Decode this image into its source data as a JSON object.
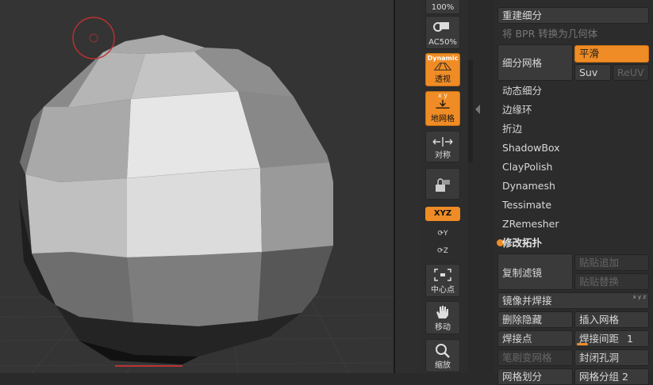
{
  "shelf": {
    "top_partial_label": "100%",
    "ac50_label": "AC50%",
    "persp_label": "透视",
    "persp_tag": "Dynamic",
    "floor_label": "地网格",
    "floor_axes": "x  y",
    "sym_label": "对称",
    "xyz_label": "XYZ",
    "y_label": "Y",
    "z_label": "Z",
    "frame_label": "中心点",
    "move_label": "移动",
    "scale_label": "缩放"
  },
  "panel": {
    "rebuild": "重建细分",
    "bpr_to_geo": "将 BPR 转换为几何体",
    "subdivide": "细分网格",
    "smooth": "平滑",
    "suv": "Suv",
    "reuv": "ReUV",
    "dynamic_subdiv": "动态细分",
    "edge_loop": "边缘环",
    "crease": "折边",
    "shadowbox": "ShadowBox",
    "claypolish": "ClayPolish",
    "dynamesh": "Dynamesh",
    "tessimate": "Tessimate",
    "zremesher": "ZRemesher",
    "modify_topo": "修改拓扑",
    "copy_filter": "复制滤镜",
    "paste_append": "贴贴追加",
    "paste_replace": "贴贴替换",
    "mirror_weld": "镜像并焊接",
    "mirror_corner": "x y z",
    "del_hidden": "删除隐藏",
    "insert_mesh": "插入网格",
    "weld_points": "焊接点",
    "weld_dist": "焊接间距",
    "weld_dist_value": "1",
    "weld_dist_fill": 0.15,
    "brush_mesh": "笔刷变网格",
    "close_holes": "封闭孔洞",
    "grid_bottom_left": "网格划分",
    "grid_bottom_right": "网格分组 2"
  }
}
